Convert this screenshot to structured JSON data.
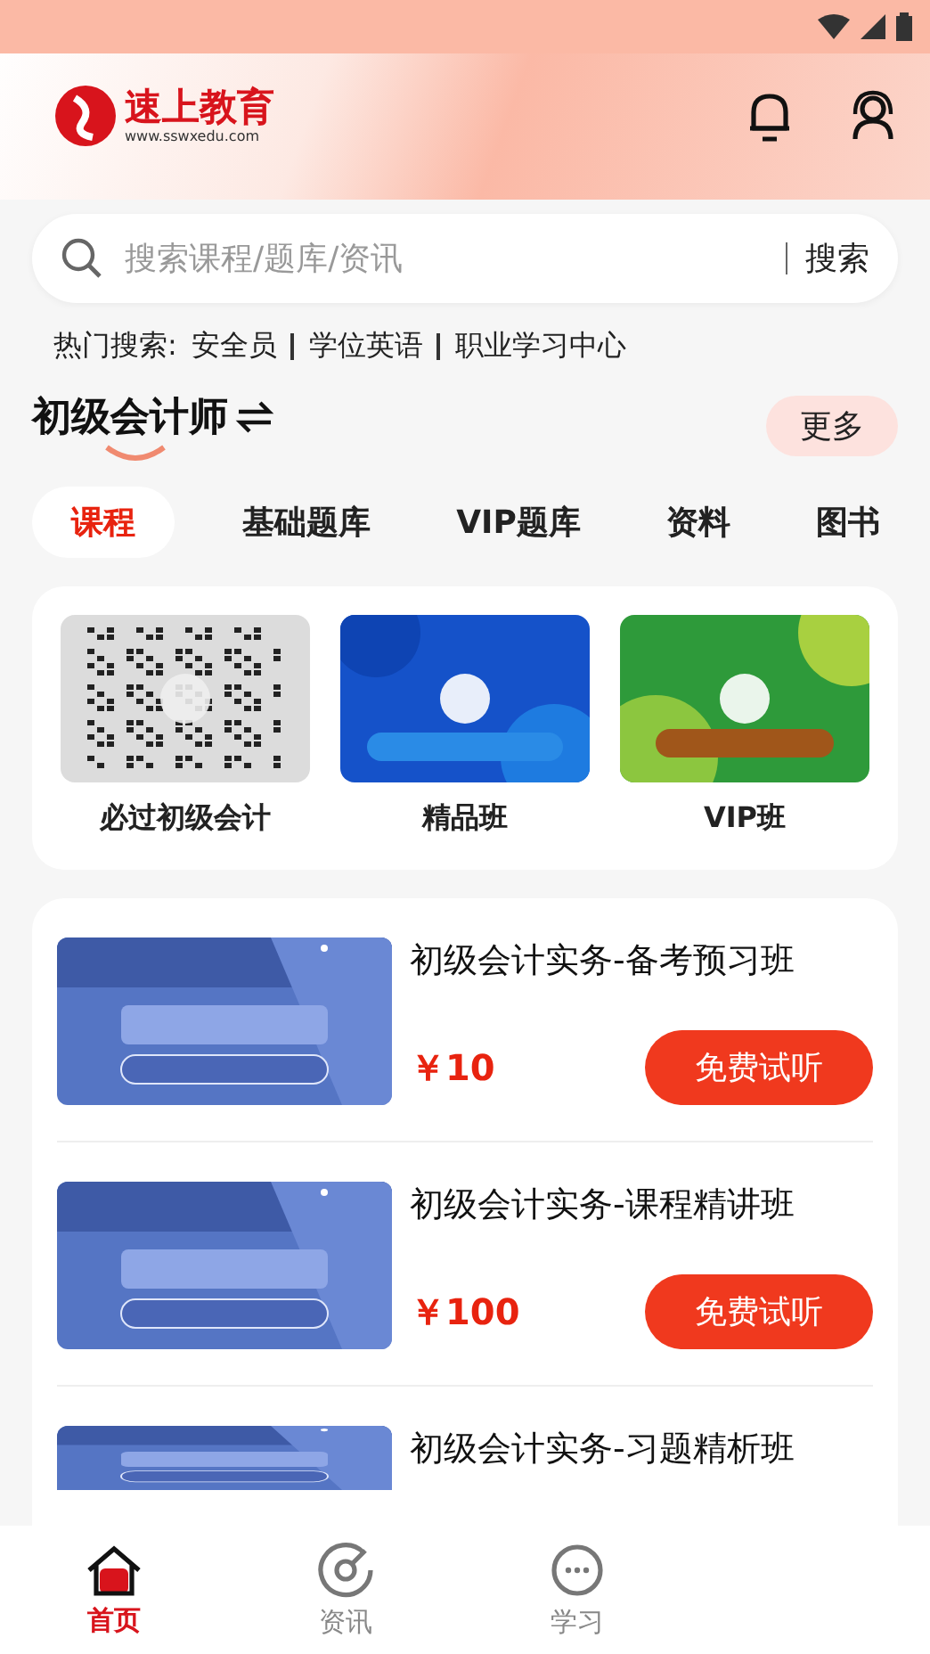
{
  "header": {
    "logo_name": "速上教育",
    "logo_url": "www.sswxedu.com"
  },
  "search": {
    "placeholder": "搜索课程/题库/资讯",
    "button": "搜索"
  },
  "hot_search": {
    "label": "热门搜索:",
    "items": [
      "安全员",
      "学位英语",
      "职业学习中心"
    ]
  },
  "section": {
    "title": "初级会计师",
    "more": "更多"
  },
  "tabs": [
    {
      "label": "课程",
      "selected": true
    },
    {
      "label": "基础题库",
      "selected": false
    },
    {
      "label": "VIP题库",
      "selected": false
    },
    {
      "label": "资料",
      "selected": false
    },
    {
      "label": "图书",
      "selected": false
    }
  ],
  "featured": [
    {
      "title": "必过初级会计",
      "kind": "qr"
    },
    {
      "title": "精品班",
      "kind": "blue"
    },
    {
      "title": "VIP班",
      "kind": "green"
    }
  ],
  "courses": [
    {
      "title": "初级会计实务-备考预习班",
      "price": "￥10",
      "button": "免费试听"
    },
    {
      "title": "初级会计实务-课程精讲班",
      "price": "￥100",
      "button": "免费试听"
    },
    {
      "title": "初级会计实务-习题精析班"
    }
  ],
  "bottom_nav": [
    {
      "label": "首页",
      "selected": true,
      "kind": "home"
    },
    {
      "label": "资讯",
      "selected": false,
      "kind": "news"
    },
    {
      "label": "学习",
      "selected": false,
      "kind": "study"
    }
  ]
}
